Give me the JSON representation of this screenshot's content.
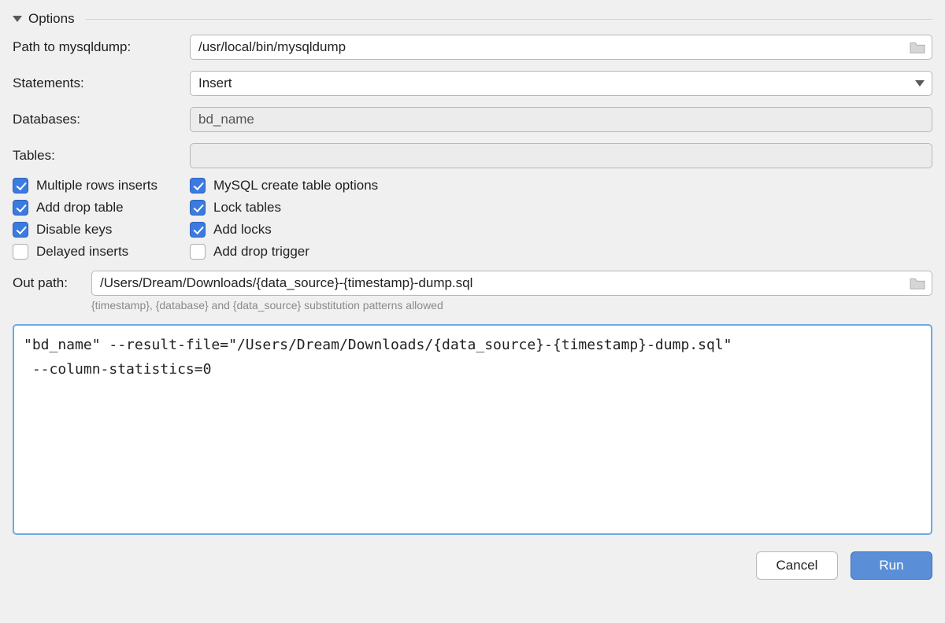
{
  "section": {
    "title": "Options"
  },
  "fields": {
    "path_label": "Path to mysqldump:",
    "path_value": "/usr/local/bin/mysqldump",
    "statements_label": "Statements:",
    "statements_value": "Insert",
    "databases_label": "Databases:",
    "databases_value": "bd_name",
    "tables_label": "Tables:",
    "tables_value": ""
  },
  "checkboxes": {
    "multiple_rows": {
      "label": "Multiple rows inserts",
      "checked": true
    },
    "mysql_create": {
      "label": "MySQL create table options",
      "checked": true
    },
    "add_drop_table": {
      "label": "Add drop table",
      "checked": true
    },
    "lock_tables": {
      "label": "Lock tables",
      "checked": true
    },
    "disable_keys": {
      "label": "Disable keys",
      "checked": true
    },
    "add_locks": {
      "label": "Add locks",
      "checked": true
    },
    "delayed": {
      "label": "Delayed inserts",
      "checked": false
    },
    "add_drop_trig": {
      "label": "Add drop trigger",
      "checked": false
    }
  },
  "out": {
    "label": "Out path:",
    "value": "/Users/Dream/Downloads/{data_source}-{timestamp}-dump.sql",
    "hint": "{timestamp}, {database} and {data_source} substitution patterns allowed"
  },
  "command": "\"bd_name\" --result-file=\"/Users/Dream/Downloads/{data_source}-{timestamp}-dump.sql\"\n --column-statistics=0",
  "buttons": {
    "cancel": "Cancel",
    "run": "Run"
  }
}
